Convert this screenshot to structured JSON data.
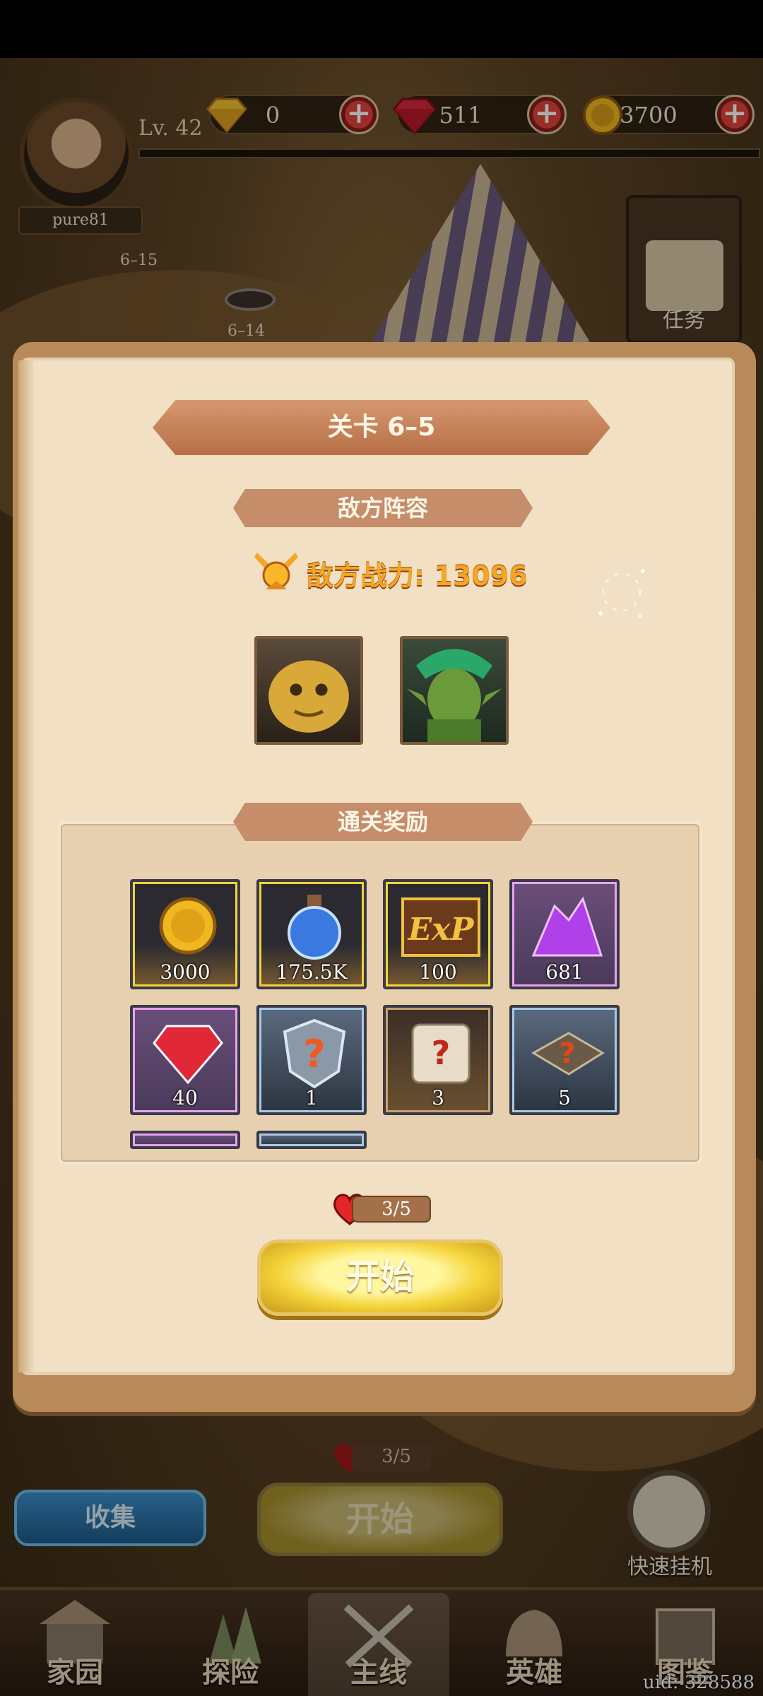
{
  "player": {
    "name": "pure81",
    "level": "Lv. 42"
  },
  "resources": [
    {
      "icon": "yellow-diamond-icon",
      "value": "0"
    },
    {
      "icon": "red-gem-icon",
      "value": "511"
    },
    {
      "icon": "gold-coin-icon",
      "value": "3700"
    }
  ],
  "map": {
    "stages": [
      "6–15",
      "6–14"
    ],
    "quest_label": "任务"
  },
  "modal": {
    "stage_title": "关卡 6–5",
    "enemy_section": "敌方阵容",
    "enemy_power": "敌方战力: 13096",
    "enemies": [
      "golden-blob-enemy",
      "goblin-enemy"
    ],
    "reward_section": "通关奖励",
    "rewards": [
      {
        "name": "gold-coin",
        "qty": "3000",
        "quality": "gold"
      },
      {
        "name": "blue-potion",
        "qty": "175.5K",
        "quality": "gold"
      },
      {
        "name": "exp-book",
        "qty": "100",
        "quality": "gold"
      },
      {
        "name": "purple-crystal",
        "qty": "681",
        "quality": "purple"
      },
      {
        "name": "red-gem",
        "qty": "40",
        "quality": "purple"
      },
      {
        "name": "mystery-shield",
        "qty": "1",
        "quality": "blue"
      },
      {
        "name": "mystery-scroll",
        "qty": "3",
        "quality": "brown"
      },
      {
        "name": "mystery-book",
        "qty": "5",
        "quality": "blue"
      }
    ],
    "stamina": "3/5",
    "start_label": "开始"
  },
  "bottom": {
    "stamina": "3/5",
    "collect_label": "收集",
    "start_label": "开始",
    "idle_label": "快速挂机"
  },
  "nav": [
    {
      "label": "家园",
      "active": false
    },
    {
      "label": "探险",
      "active": false
    },
    {
      "label": "主线",
      "active": true
    },
    {
      "label": "英雄",
      "active": false
    },
    {
      "label": "图鉴",
      "active": false
    }
  ],
  "uid": "uid: 328588",
  "colors": {
    "parchment": "#f1e0c3",
    "ribbon": "#c58d69",
    "power_text": "#f5a623",
    "start_button": "#f4d43a"
  }
}
